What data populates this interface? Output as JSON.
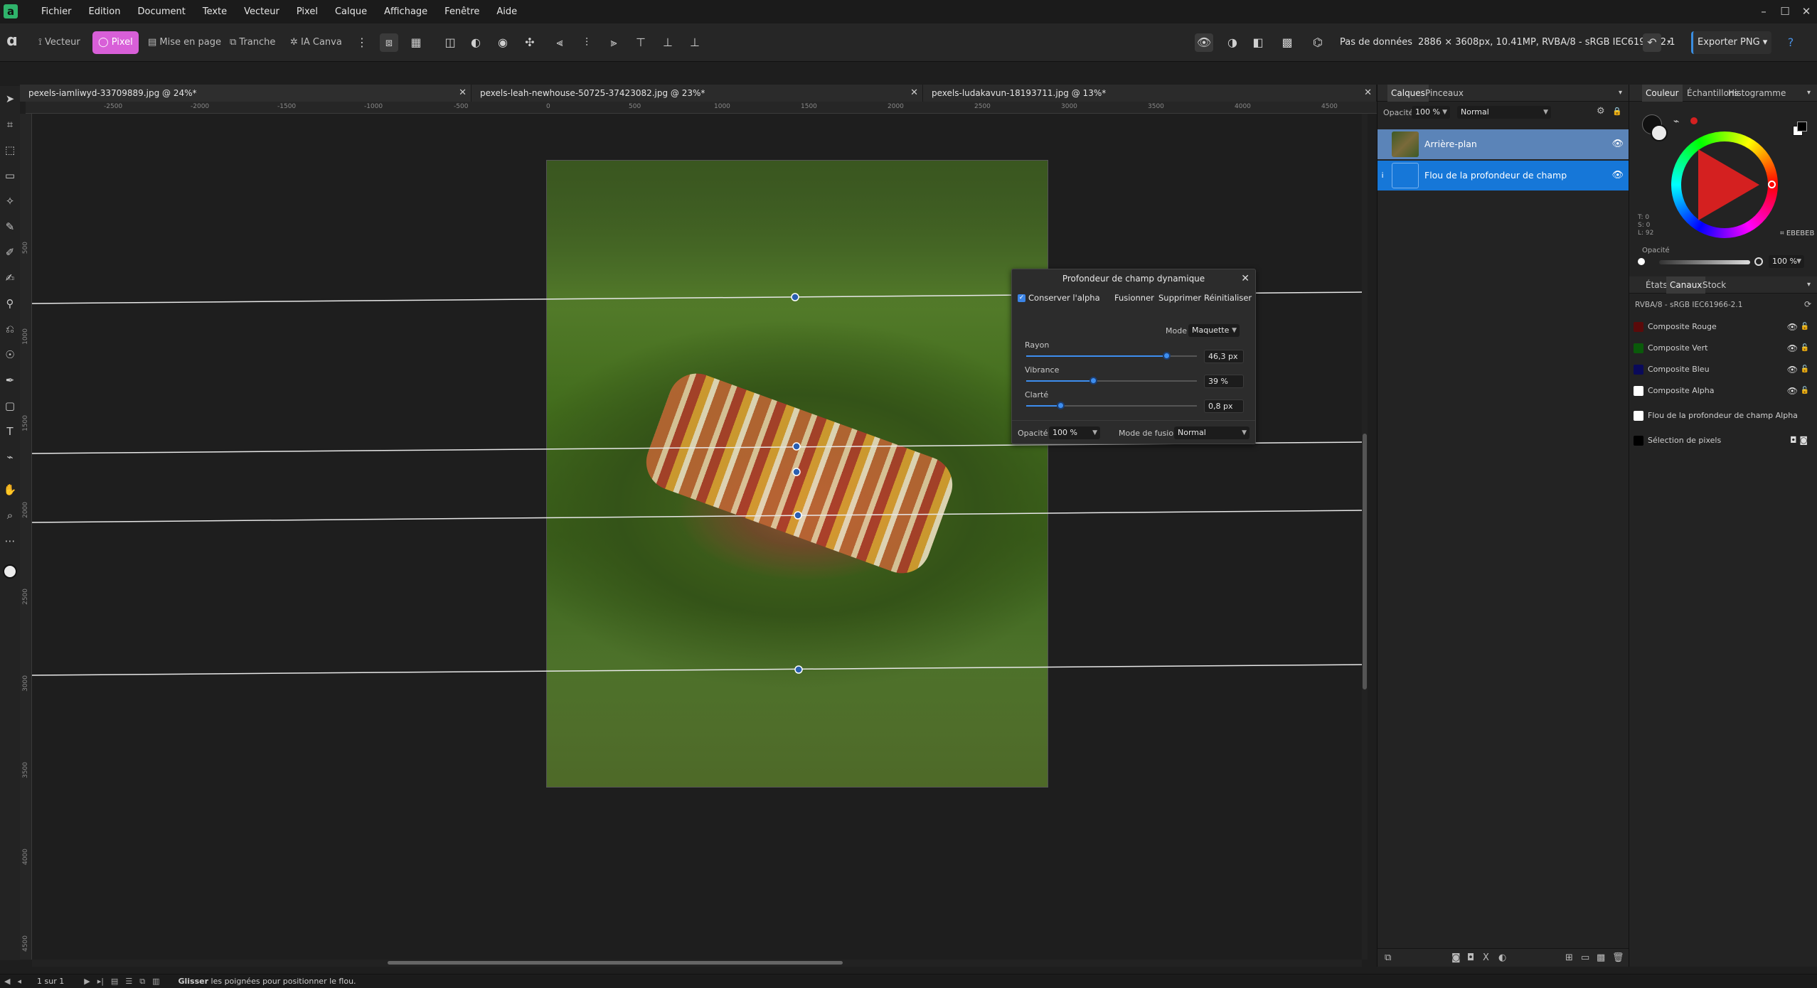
{
  "menubar": {
    "logo": "a",
    "items": [
      "Fichier",
      "Edition",
      "Document",
      "Texte",
      "Vecteur",
      "Pixel",
      "Calque",
      "Affichage",
      "Fenêtre",
      "Aide"
    ]
  },
  "toolbar": {
    "personas": {
      "vecteur": "Vecteur",
      "pixel": "Pixel",
      "mise_en_page": "Mise en page",
      "tranche": "Tranche",
      "ia_canva": "IA Canva"
    },
    "pas_de_donnees": "Pas de données",
    "doc_info": "2886 × 3608px, 10.41MP, RVBA/8 - sRGB IEC61966-2.1",
    "export": "Exporter PNG"
  },
  "tabs": [
    {
      "label": "pexels-iamliwyd-33709889.jpg @ 24%*"
    },
    {
      "label": "pexels-leah-newhouse-50725-37423082.jpg @ 23%*"
    },
    {
      "label": "pexels-ludakavun-18193711.jpg @ 13%*"
    }
  ],
  "ruler_h": [
    "-2500",
    "-2000",
    "-1500",
    "-1000",
    "-500",
    "0",
    "500",
    "1000",
    "1500",
    "2000",
    "2500",
    "3000",
    "3500",
    "4000",
    "4500"
  ],
  "ruler_v": [
    "500",
    "1000",
    "1500",
    "2000",
    "2500",
    "3000",
    "3500",
    "4000",
    "4500"
  ],
  "dof_dialog": {
    "title": "Profondeur de champ dynamique",
    "preserve_alpha": "Conserver l'alpha",
    "merge": "Fusionner",
    "delete": "Supprimer",
    "reset": "Réinitialiser",
    "mode_label": "Mode",
    "mode_value": "Maquette",
    "sliders": [
      {
        "label": "Rayon",
        "value": "46,3 px",
        "fraction": 0.82
      },
      {
        "label": "Vibrance",
        "value": "39 %",
        "fraction": 0.39
      },
      {
        "label": "Clarté",
        "value": "0,8 px",
        "fraction": 0.2
      }
    ],
    "opacity_label": "Opacité:",
    "opacity_value": "100 %",
    "blend_label": "Mode de fusion:",
    "blend_value": "Normal"
  },
  "layers_panel": {
    "tabs": [
      "Calques",
      "Pinceaux"
    ],
    "opacity_label": "Opacité:",
    "opacity_value": "100 %",
    "blend_value": "Normal",
    "layers": [
      {
        "name": "Arrière-plan"
      },
      {
        "name": "Flou de la profondeur de champ"
      }
    ]
  },
  "color_panel": {
    "tabs": [
      "Couleur",
      "Échantillons",
      "Histogramme"
    ],
    "tsl": [
      "T: 0",
      "S: 0",
      "L: 92"
    ],
    "hex": "EBEBEB",
    "opacity_label": "Opacité",
    "opacity_value": "100 %",
    "accent": "#d42020"
  },
  "channels_panel": {
    "tabs": [
      "États",
      "Canaux",
      "Stock"
    ],
    "profile": "RVBA/8 - sRGB IEC61966-2.1",
    "channels": [
      {
        "name": "Composite Rouge",
        "color": "#5a0a0a"
      },
      {
        "name": "Composite Vert",
        "color": "#0a5a0a"
      },
      {
        "name": "Composite Bleu",
        "color": "#0a0a5a"
      },
      {
        "name": "Composite Alpha",
        "color": "#ffffff"
      }
    ],
    "extra": [
      {
        "name": "Flou de la profondeur de champ Alpha",
        "color": "#ffffff"
      },
      {
        "name": "Sélection de pixels",
        "color": "#000000"
      }
    ]
  },
  "status": {
    "page": "1 sur 1",
    "hint_bold": "Glisser",
    "hint_rest": " les poignées pour positionner le flou."
  }
}
